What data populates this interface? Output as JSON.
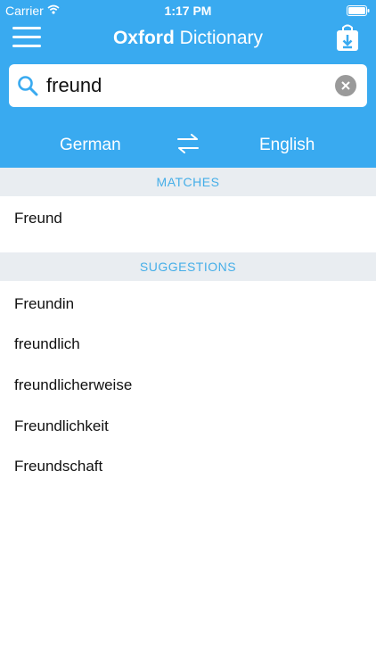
{
  "status_bar": {
    "carrier": "Carrier",
    "time": "1:17 PM"
  },
  "header": {
    "title_bold": "Oxford",
    "title_rest": " Dictionary",
    "accent_color": "#39aaf0",
    "menu_icon": "hamburger-menu-icon",
    "download_icon": "download-bag-icon"
  },
  "search": {
    "query": "freund",
    "icon": "search-icon",
    "clear_icon": "clear-icon"
  },
  "languages": {
    "source": "German",
    "target": "English",
    "swap_icon": "swap-arrows-icon"
  },
  "matches": {
    "header": "MATCHES",
    "items": [
      "Freund"
    ]
  },
  "suggestions": {
    "header": "SUGGESTIONS",
    "items": [
      "Freundin",
      "freundlich",
      "freundlicherweise",
      "Freundlichkeit",
      "Freundschaft"
    ]
  }
}
